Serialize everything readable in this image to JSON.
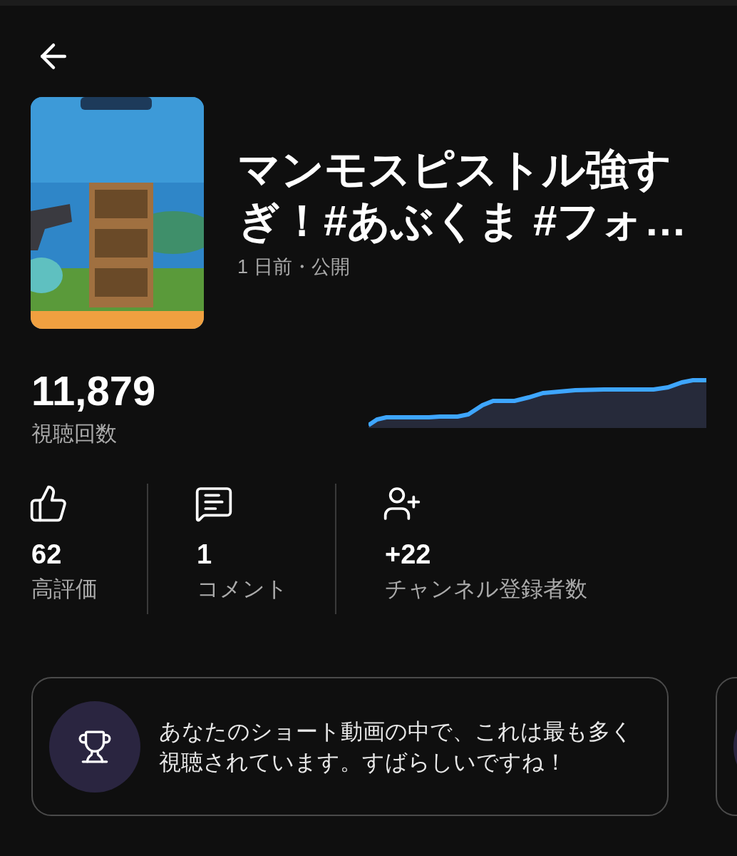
{
  "video": {
    "title": "マンモスピストル強すぎ！#あぶくま #フォ…",
    "meta": "1 日前・公開"
  },
  "views": {
    "value": "11,879",
    "label": "視聴回数"
  },
  "stats": [
    {
      "kind": "like",
      "value": "62",
      "label": "高評価"
    },
    {
      "kind": "comment",
      "value": "1",
      "label": "コメント"
    },
    {
      "kind": "subscriber",
      "value": "+22",
      "label": "チャンネル登録者数"
    }
  ],
  "insights": [
    {
      "kind": "trophy",
      "text": "あなたのショート動画の中で、これは最も多く視聴されています。すばらしいですね！"
    },
    {
      "kind": "partial"
    }
  ]
}
